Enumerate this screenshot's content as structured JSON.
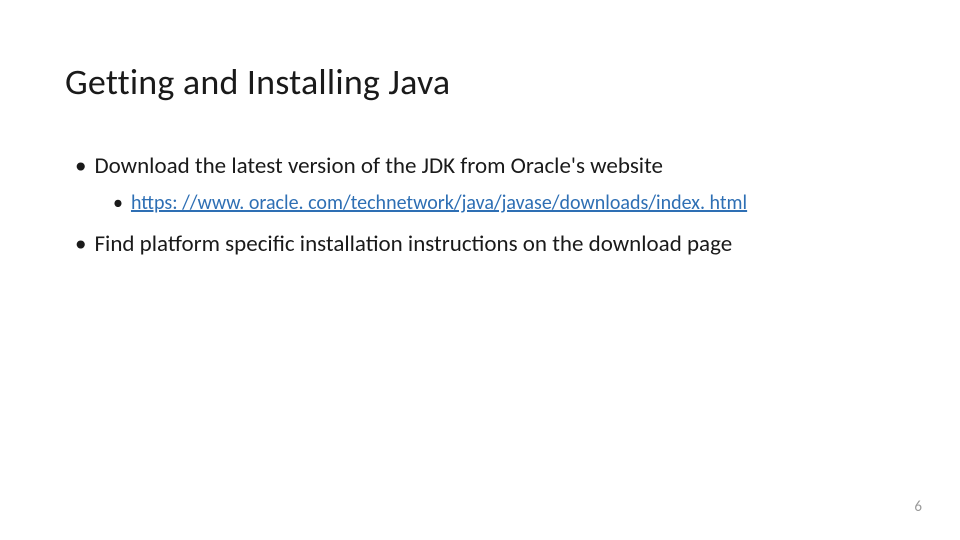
{
  "slide": {
    "title": "Getting and Installing Java",
    "bullets": {
      "b1": "Download the latest version of the JDK from Oracle's website",
      "b1a_link": "https: //www. oracle. com/technetwork/java/javase/downloads/index. html",
      "b2": "Find platform specific installation instructions on the download page"
    },
    "page_number": "6"
  }
}
